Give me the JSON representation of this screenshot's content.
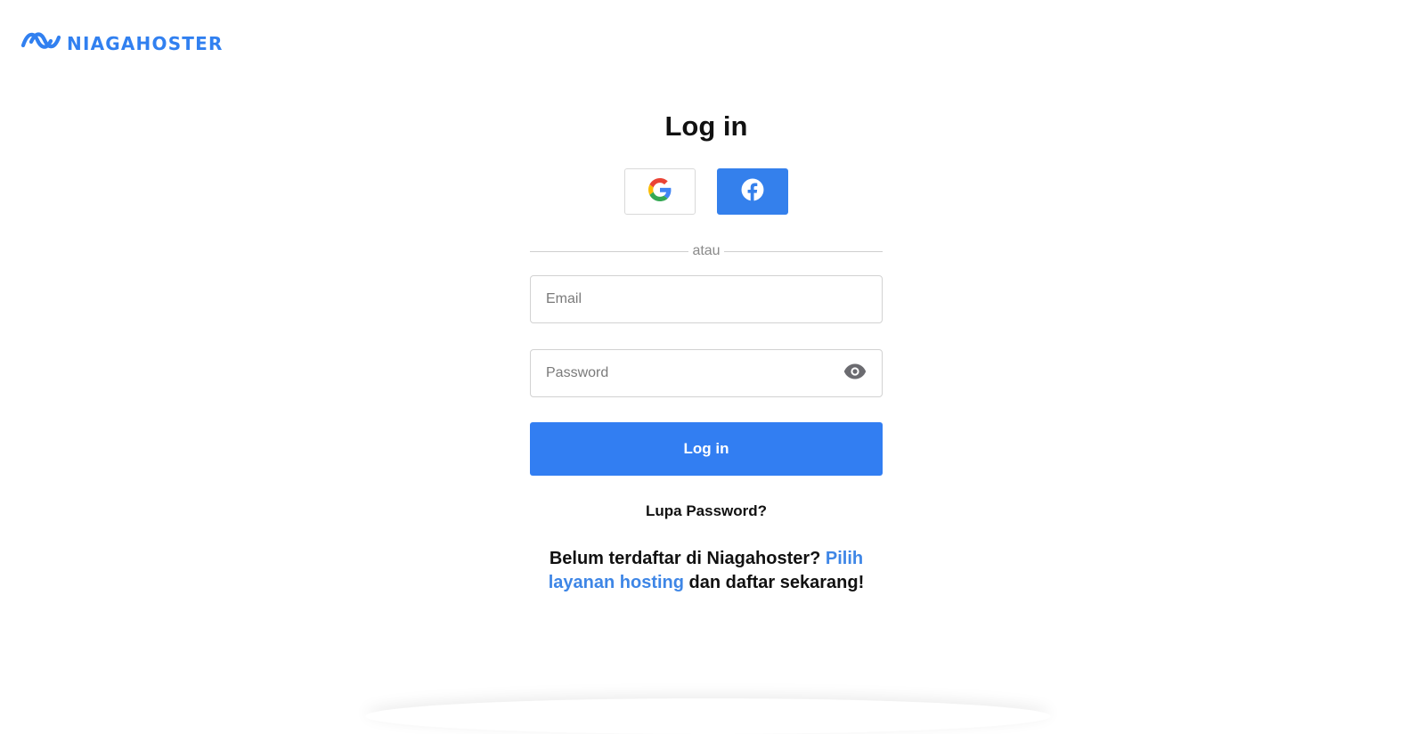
{
  "brand": {
    "name": "NIAGAHOSTER",
    "color": "#3180f0",
    "icon": "niagahoster-wave-logo"
  },
  "login": {
    "title": "Log in",
    "social": {
      "google": {
        "icon": "google-icon"
      },
      "facebook": {
        "icon": "facebook-icon",
        "color": "#3480ec"
      }
    },
    "divider_text": "atau",
    "email": {
      "placeholder": "Email",
      "value": ""
    },
    "password": {
      "placeholder": "Password",
      "value": "",
      "toggle_icon": "eye-icon"
    },
    "submit_label": "Log in",
    "submit_color": "#327ef2",
    "forgot_label": "Lupa Password?"
  },
  "signup": {
    "prefix": "Belum terdaftar di Niagahoster? ",
    "link_text": "Pilih layanan hosting",
    "suffix": " dan daftar sekarang!",
    "link_color": "#3e86e6"
  }
}
